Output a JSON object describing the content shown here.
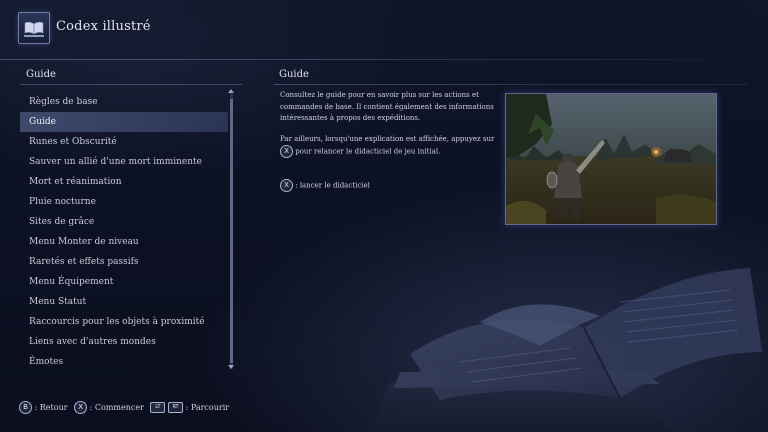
{
  "header": {
    "title": "Codex illustré",
    "icon": "open-book-icon"
  },
  "left_panel": {
    "heading": "Guide",
    "selected_index": 1,
    "items": [
      "Règles de base",
      "Guide",
      "Runes et Obscurité",
      "Sauver un allié d'une mort imminente",
      "Mort et réanimation",
      "Pluie nocturne",
      "Sites de grâce",
      "Menu Monter de niveau",
      "Raretés et effets passifs",
      "Menu Équipement",
      "Menu Statut",
      "Raccourcis pour les objets à proximité",
      "Liens avec d'autres mondes",
      "Émotes"
    ]
  },
  "right_panel": {
    "heading": "Guide",
    "paragraph1": "Consultez le guide pour en savoir plus sur les actions et commandes de base. Il contient également des informations intéressantes à propos des expéditions.",
    "paragraph2_before": "Par ailleurs, lorsqu'une explication est affichée, appuyez sur",
    "paragraph2_button": "X",
    "paragraph2_after": "pour relancer le didacticiel de jeu initial.",
    "launch_button": "X",
    "launch_label": ": lancer le didacticiel"
  },
  "footer": {
    "back_button": "B",
    "back_label": ": Retour",
    "start_button": "X",
    "start_label": ": Commencer",
    "lt_button": "LT",
    "rt_button": "RT",
    "browse_label": ": Parcourir"
  },
  "colors": {
    "background": "#0b0f1e",
    "selection": "#46527a",
    "text": "#cfd2de",
    "accent": "#5c6a93"
  }
}
